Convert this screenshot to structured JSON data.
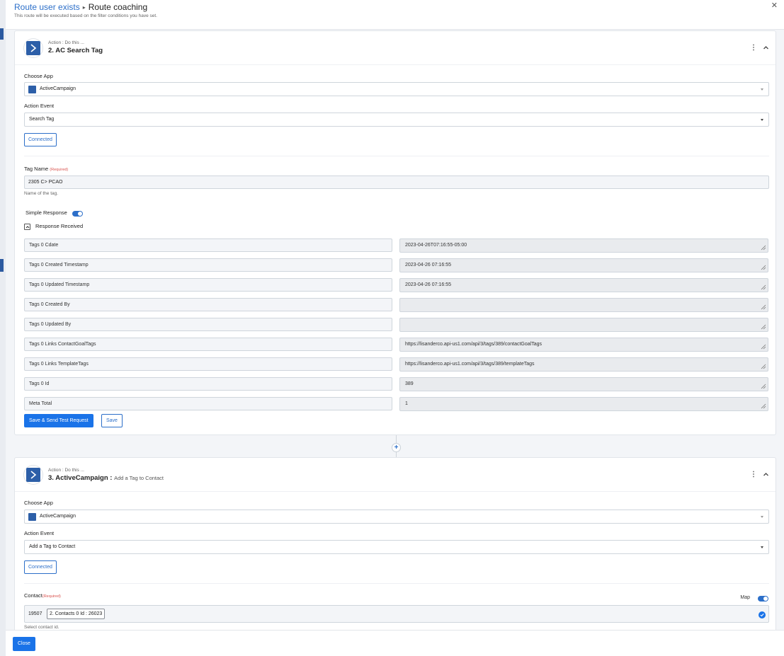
{
  "header": {
    "crumb_parent": "Route user exists",
    "crumb_current": "Route coaching",
    "subtitle": "This route will be executed based on the filter conditions you have set."
  },
  "step2": {
    "caption": "Action : Do this ...",
    "title": "2. AC Search Tag",
    "choose_app_label": "Choose App",
    "app_value": "ActiveCampaign",
    "action_event_label": "Action Event",
    "action_event_value": "Search Tag",
    "connected_label": "Connected",
    "tag_name_label": "Tag Name",
    "required_text": "(Required)",
    "tag_name_value": "2305 C> PCAO",
    "tag_name_hint": "Name of the tag.",
    "simple_response_label": "Simple Response",
    "simple_response_on": true,
    "response_received_label": "Response Received",
    "responses": [
      {
        "key": "Tags 0 Cdate",
        "value": "2023-04-26T07:16:55-05:00"
      },
      {
        "key": "Tags 0 Created Timestamp",
        "value": "2023-04-26 07:16:55"
      },
      {
        "key": "Tags 0 Updated Timestamp",
        "value": "2023-04-26 07:16:55"
      },
      {
        "key": "Tags 0 Created By",
        "value": ""
      },
      {
        "key": "Tags 0 Updated By",
        "value": ""
      },
      {
        "key": "Tags 0 Links ContactGoalTags",
        "value": "https://lisanderco.api-us1.com/api/3/tags/389/contactGoalTags"
      },
      {
        "key": "Tags 0 Links TemplateTags",
        "value": "https://lisanderco.api-us1.com/api/3/tags/389/templateTags"
      },
      {
        "key": "Tags 0 Id",
        "value": "389"
      },
      {
        "key": "Meta Total",
        "value": "1"
      }
    ],
    "save_send_label": "Save & Send Test Request",
    "save_label": "Save"
  },
  "add_step_symbol": "+",
  "step3": {
    "caption": "Action : Do this ...",
    "title": "3. ActiveCampaign : ",
    "event_suffix": "Add a Tag to Contact",
    "choose_app_label": "Choose App",
    "app_value": "ActiveCampaign",
    "action_event_label": "Action Event",
    "action_event_value": "Add a Tag to Contact",
    "connected_label": "Connected",
    "contact_label": "Contact",
    "required_text": "(Required)",
    "map_label": "Map",
    "map_on": true,
    "contact_prefix": "19507",
    "contact_pill": "2. Contacts 0 Id : 26023",
    "contact_hint": "Select contact id."
  },
  "footer": {
    "close_label": "Close"
  },
  "colors": {
    "accent": "#1a73e8",
    "link": "#2c6fc9",
    "app_brand": "#2d5fa8",
    "required": "#d9534f"
  },
  "icons": [
    "activecampaign-icon",
    "kebab-icon",
    "chevron-up-icon",
    "caret-down-icon",
    "close-icon",
    "plus-icon",
    "check-icon",
    "resize-grip-icon"
  ]
}
